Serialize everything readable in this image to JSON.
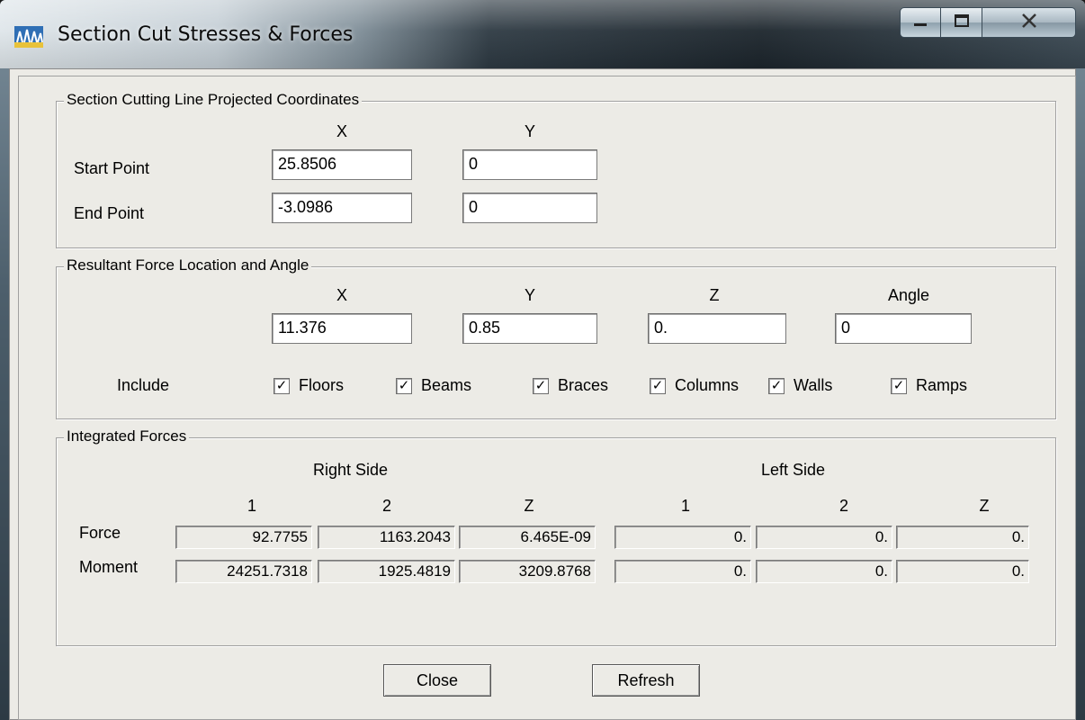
{
  "window": {
    "title": "Section Cut Stresses & Forces",
    "controls": {
      "minimize": "—",
      "maximize": "□",
      "close": "X"
    }
  },
  "section_cutting": {
    "label": "Section Cutting Line Projected Coordinates",
    "col_x": "X",
    "col_y": "Y",
    "start": {
      "label": "Start Point",
      "x": "25.8506",
      "y": "0"
    },
    "end": {
      "label": "End Point",
      "x": "-3.0986",
      "y": "0"
    }
  },
  "resultant": {
    "label": "Resultant Force Location and Angle",
    "col_x": "X",
    "col_y": "Y",
    "col_z": "Z",
    "col_angle": "Angle",
    "x": "11.376",
    "y": "0.85",
    "z": "0.",
    "angle": "0",
    "include_label": "Include",
    "include": [
      {
        "label": "Floors",
        "checked": true
      },
      {
        "label": "Beams",
        "checked": true
      },
      {
        "label": "Braces",
        "checked": true
      },
      {
        "label": "Columns",
        "checked": true
      },
      {
        "label": "Walls",
        "checked": true
      },
      {
        "label": "Ramps",
        "checked": true
      }
    ],
    "check_mark": "✓"
  },
  "integrated": {
    "label": "Integrated Forces",
    "right_side": "Right Side",
    "left_side": "Left Side",
    "cols": [
      "1",
      "2",
      "Z",
      "1",
      "2",
      "Z"
    ],
    "force": {
      "label": "Force",
      "values": [
        "92.7755",
        "1163.2043",
        "6.465E-09",
        "0.",
        "0.",
        "0."
      ]
    },
    "moment": {
      "label": "Moment",
      "values": [
        "24251.7318",
        "1925.4819",
        "3209.8768",
        "0.",
        "0.",
        "0."
      ]
    }
  },
  "buttons": {
    "close": "Close",
    "refresh": "Refresh"
  }
}
